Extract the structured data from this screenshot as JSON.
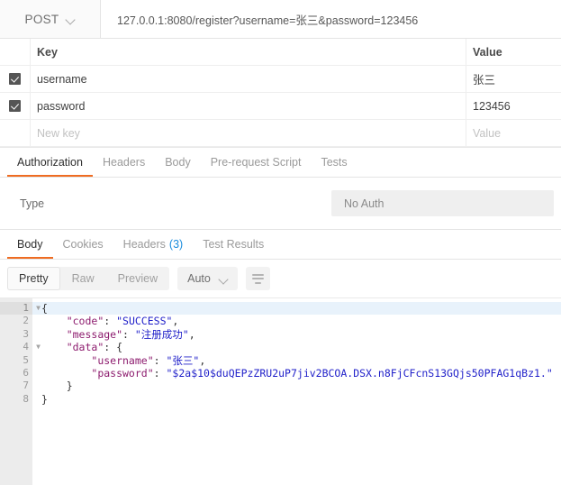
{
  "request": {
    "method": "POST",
    "method_caret_icon": "chevron-down-icon",
    "url": "127.0.0.1:8080/register?username=张三&password=123456"
  },
  "params": {
    "columns": {
      "key": "Key",
      "value": "Value"
    },
    "rows": [
      {
        "checked": true,
        "key": "username",
        "value": "张三"
      },
      {
        "checked": true,
        "key": "password",
        "value": "123456"
      }
    ],
    "new_row": {
      "key_placeholder": "New key",
      "value_placeholder": "Value"
    }
  },
  "request_tabs": {
    "items": [
      {
        "label": "Authorization",
        "active": true
      },
      {
        "label": "Headers",
        "active": false
      },
      {
        "label": "Body",
        "active": false
      },
      {
        "label": "Pre-request Script",
        "active": false
      },
      {
        "label": "Tests",
        "active": false
      }
    ]
  },
  "auth": {
    "type_label": "Type",
    "type_value": "No Auth"
  },
  "response_tabs": {
    "items": [
      {
        "label": "Body",
        "count": "",
        "active": true
      },
      {
        "label": "Cookies",
        "count": "",
        "active": false
      },
      {
        "label": "Headers",
        "count": "(3)",
        "active": false
      },
      {
        "label": "Test Results",
        "count": "",
        "active": false
      }
    ]
  },
  "format_bar": {
    "segments": [
      {
        "label": "Pretty",
        "active": true
      },
      {
        "label": "Raw",
        "active": false
      },
      {
        "label": "Preview",
        "active": false
      }
    ],
    "language": "Auto",
    "language_caret_icon": "chevron-down-icon",
    "wrap_icon": "word-wrap-icon"
  },
  "response_body": {
    "language": "json",
    "gutter": [
      "1",
      "2",
      "3",
      "4",
      "5",
      "6",
      "7",
      "8"
    ],
    "fold_lines": [
      "1",
      "4"
    ],
    "highlighted_line": "1",
    "raw": "{\n    \"code\": \"SUCCESS\",\n    \"message\": \"注册成功\",\n    \"data\": {\n        \"username\": \"张三\",\n        \"password\": \"$2a$10$duQEPzZRU2uP7jiv2BCOA.DSX.n8FjCFcnS13GQjs50PFAG1qBz1.\"\n    }\n}",
    "json": {
      "code": "SUCCESS",
      "message": "注册成功",
      "data": {
        "username": "张三",
        "password": "$2a$10$duQEPzZRU2uP7jiv2BCOA.DSX.n8FjCFcnS13GQjs50PFAG1qBz1."
      }
    },
    "lines": [
      {
        "n": "1",
        "indent": 0,
        "parts": [
          {
            "t": "{",
            "c": "p"
          }
        ]
      },
      {
        "n": "2",
        "indent": 4,
        "parts": [
          {
            "t": "\"code\"",
            "c": "k"
          },
          {
            "t": ": ",
            "c": "p"
          },
          {
            "t": "\"SUCCESS\"",
            "c": "s"
          },
          {
            "t": ",",
            "c": "p"
          }
        ]
      },
      {
        "n": "3",
        "indent": 4,
        "parts": [
          {
            "t": "\"message\"",
            "c": "k"
          },
          {
            "t": ": ",
            "c": "p"
          },
          {
            "t": "\"注册成功\"",
            "c": "s"
          },
          {
            "t": ",",
            "c": "p"
          }
        ]
      },
      {
        "n": "4",
        "indent": 4,
        "parts": [
          {
            "t": "\"data\"",
            "c": "k"
          },
          {
            "t": ": {",
            "c": "p"
          }
        ]
      },
      {
        "n": "5",
        "indent": 8,
        "parts": [
          {
            "t": "\"username\"",
            "c": "k"
          },
          {
            "t": ": ",
            "c": "p"
          },
          {
            "t": "\"张三\"",
            "c": "s"
          },
          {
            "t": ",",
            "c": "p"
          }
        ]
      },
      {
        "n": "6",
        "indent": 8,
        "parts": [
          {
            "t": "\"password\"",
            "c": "k"
          },
          {
            "t": ": ",
            "c": "p"
          },
          {
            "t": "\"$2a$10$duQEPzZRU2uP7jiv2BCOA.DSX.n8FjCFcnS13GQjs50PFAG1qBz1.\"",
            "c": "s"
          }
        ]
      },
      {
        "n": "7",
        "indent": 4,
        "parts": [
          {
            "t": "}",
            "c": "p"
          }
        ]
      },
      {
        "n": "8",
        "indent": 0,
        "parts": [
          {
            "t": "}",
            "c": "p"
          }
        ]
      }
    ]
  },
  "colors": {
    "accent": "#ef6c22",
    "link": "#1a8cdd",
    "json_key": "#8d1c6e",
    "json_string": "#1f1fc9",
    "gutter_bg": "#ececec",
    "highlight_line": "#e8f2fb"
  }
}
